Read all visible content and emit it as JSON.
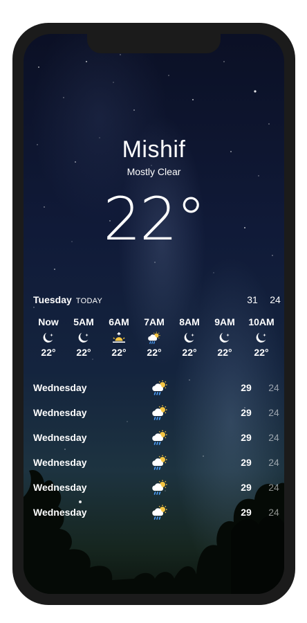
{
  "location": {
    "city": "Mishif",
    "condition": "Mostly Clear",
    "temperature": "22°"
  },
  "today": {
    "day": "Tuesday",
    "tag": "TODAY",
    "high": "31",
    "low": "24"
  },
  "hourly": [
    {
      "time": "Now",
      "icon": "moon-star-icon",
      "temp": "22°"
    },
    {
      "time": "5AM",
      "icon": "moon-star-icon",
      "temp": "22°"
    },
    {
      "time": "6AM",
      "icon": "sunrise-icon",
      "temp": "22°"
    },
    {
      "time": "7AM",
      "icon": "sun-cloud-rain-icon",
      "temp": "22°"
    },
    {
      "time": "8AM",
      "icon": "moon-star-icon",
      "temp": "22°"
    },
    {
      "time": "9AM",
      "icon": "moon-star-icon",
      "temp": "22°"
    },
    {
      "time": "10AM",
      "icon": "moon-star-icon",
      "temp": "22°"
    }
  ],
  "daily": [
    {
      "day": "Wednesday",
      "icon": "sun-cloud-rain-icon",
      "high": "29",
      "low": "24"
    },
    {
      "day": "Wednesday",
      "icon": "sun-cloud-rain-icon",
      "high": "29",
      "low": "24"
    },
    {
      "day": "Wednesday",
      "icon": "sun-cloud-rain-icon",
      "high": "29",
      "low": "24"
    },
    {
      "day": "Wednesday",
      "icon": "sun-cloud-rain-icon",
      "high": "29",
      "low": "24"
    },
    {
      "day": "Wednesday",
      "icon": "sun-cloud-rain-icon",
      "high": "29",
      "low": "24"
    },
    {
      "day": "Wednesday",
      "icon": "sun-cloud-rain-icon",
      "high": "29",
      "low": "24"
    }
  ]
}
